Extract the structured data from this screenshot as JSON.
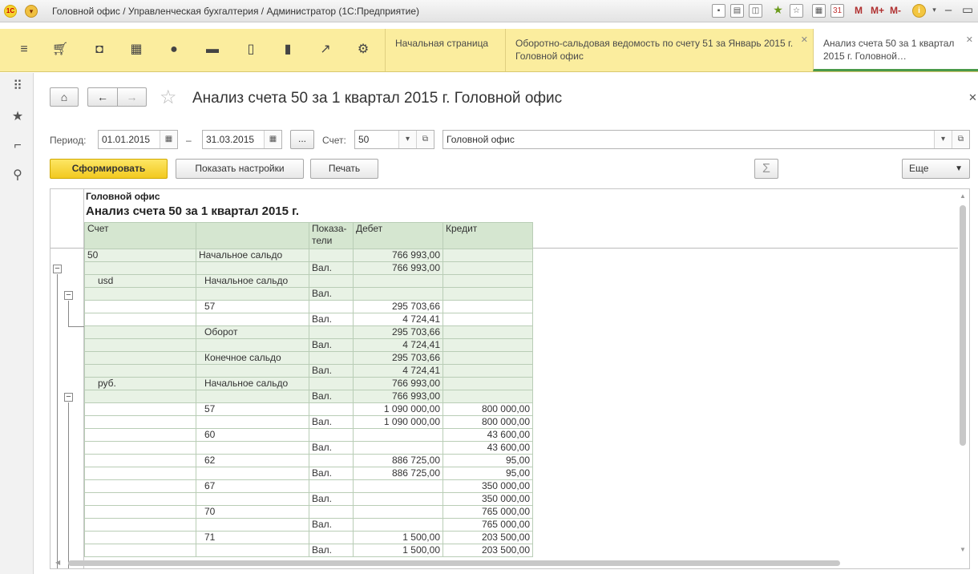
{
  "window": {
    "title": "Головной офис / Управленческая бухгалтерия / Администратор  (1С:Предприятие)",
    "m_buttons": [
      "M",
      "M+",
      "M-"
    ]
  },
  "sections": [
    {
      "icon": "menu-icon"
    },
    {
      "icon": "cart-icon"
    },
    {
      "icon": "bag-icon"
    },
    {
      "icon": "grid-icon"
    },
    {
      "icon": "ruble-icon"
    },
    {
      "icon": "truck-icon"
    },
    {
      "icon": "documents-icon"
    },
    {
      "icon": "chart-bar-icon"
    },
    {
      "icon": "trend-icon"
    },
    {
      "icon": "gear-icon"
    }
  ],
  "tabs": [
    {
      "label": "Начальная страница"
    },
    {
      "label": "Оборотно-сальдовая ведомость по счету 51 за Январь 2015 г. Головной офис"
    },
    {
      "label": "Анализ счета 50 за 1 квартал 2015 г. Головной…"
    }
  ],
  "form": {
    "title": "Анализ счета 50 за 1 квартал 2015 г. Головной офис",
    "period_label": "Период:",
    "date_from": "01.01.2015",
    "dash": "–",
    "date_to": "31.03.2015",
    "dots": "...",
    "account_label": "Счет:",
    "account": "50",
    "organization": "Головной офис",
    "generate_label": "Сформировать",
    "settings_label": "Показать настройки",
    "print_label": "Печать",
    "sigma": "Σ",
    "more_label": "Еще"
  },
  "report": {
    "org": "Головной офис",
    "title": "Анализ счета 50 за 1 квартал 2015 г.",
    "headers": {
      "account": "Счет",
      "blank": "",
      "indicators": "Показа-\nтели",
      "debit": "Дебет",
      "credit": "Кредит"
    },
    "rows": [
      {
        "a": "50",
        "b": "Начальное сальдо",
        "c": "",
        "d": "766 993,00",
        "e": ""
      },
      {
        "a": "",
        "b": "",
        "c": "Вал.",
        "d": "766 993,00",
        "e": ""
      },
      {
        "a": "usd",
        "b": "Начальное сальдо",
        "c": "",
        "d": "",
        "e": ""
      },
      {
        "a": "",
        "b": "",
        "c": "Вал.",
        "d": "",
        "e": ""
      },
      {
        "a": "",
        "b": "57",
        "c": "",
        "d": "295 703,66",
        "e": ""
      },
      {
        "a": "",
        "b": "",
        "c": "Вал.",
        "d": "4 724,41",
        "e": ""
      },
      {
        "a": "",
        "b": "Оборот",
        "c": "",
        "d": "295 703,66",
        "e": ""
      },
      {
        "a": "",
        "b": "",
        "c": "Вал.",
        "d": "4 724,41",
        "e": ""
      },
      {
        "a": "",
        "b": "Конечное сальдо",
        "c": "",
        "d": "295 703,66",
        "e": ""
      },
      {
        "a": "",
        "b": "",
        "c": "Вал.",
        "d": "4 724,41",
        "e": ""
      },
      {
        "a": "руб.",
        "b": "Начальное сальдо",
        "c": "",
        "d": "766 993,00",
        "e": ""
      },
      {
        "a": "",
        "b": "",
        "c": "Вал.",
        "d": "766 993,00",
        "e": ""
      },
      {
        "a": "",
        "b": "57",
        "c": "",
        "d": "1 090 000,00",
        "e": "800 000,00"
      },
      {
        "a": "",
        "b": "",
        "c": "Вал.",
        "d": "1 090 000,00",
        "e": "800 000,00"
      },
      {
        "a": "",
        "b": "60",
        "c": "",
        "d": "",
        "e": "43 600,00"
      },
      {
        "a": "",
        "b": "",
        "c": "Вал.",
        "d": "",
        "e": "43 600,00"
      },
      {
        "a": "",
        "b": "62",
        "c": "",
        "d": "886 725,00",
        "e": "95,00"
      },
      {
        "a": "",
        "b": "",
        "c": "Вал.",
        "d": "886 725,00",
        "e": "95,00"
      },
      {
        "a": "",
        "b": "67",
        "c": "",
        "d": "",
        "e": "350 000,00"
      },
      {
        "a": "",
        "b": "",
        "c": "Вал.",
        "d": "",
        "e": "350 000,00"
      },
      {
        "a": "",
        "b": "70",
        "c": "",
        "d": "",
        "e": "765 000,00"
      },
      {
        "a": "",
        "b": "",
        "c": "Вал.",
        "d": "",
        "e": "765 000,00"
      },
      {
        "a": "",
        "b": "71",
        "c": "",
        "d": "1 500,00",
        "e": "203 500,00"
      },
      {
        "a": "",
        "b": "",
        "c": "Вал.",
        "d": "1 500,00",
        "e": "203 500,00"
      }
    ]
  }
}
